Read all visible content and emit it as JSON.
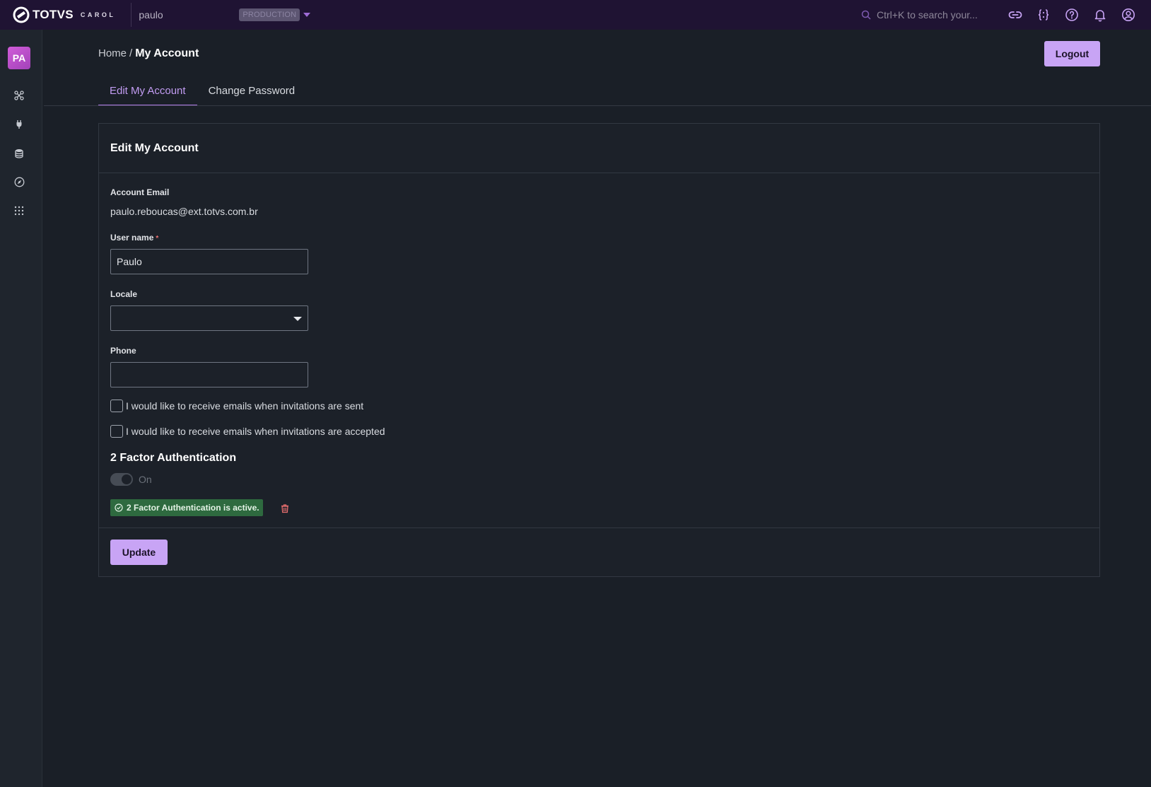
{
  "topbar": {
    "brand_name": "TOTVS",
    "brand_sub": "CAROL",
    "tenant": "paulo",
    "environment": "PRODUCTION",
    "search_placeholder": "Ctrl+K to search your...",
    "icons": [
      "link-icon",
      "code-braces-icon",
      "help-icon",
      "bell-icon",
      "user-circle-icon"
    ]
  },
  "sidebar": {
    "avatar_initials": "PA",
    "icons": [
      "pipeline-icon",
      "plug-icon",
      "database-icon",
      "compass-icon",
      "apps-grid-icon"
    ]
  },
  "breadcrumb": {
    "home": "Home",
    "separator": "/",
    "current": "My Account"
  },
  "header": {
    "logout_label": "Logout"
  },
  "tabs": [
    {
      "label": "Edit My Account",
      "active": true
    },
    {
      "label": "Change Password",
      "active": false
    }
  ],
  "form": {
    "title": "Edit My Account",
    "email_label": "Account Email",
    "email_value": "paulo.reboucas@ext.totvs.com.br",
    "username_label": "User name",
    "username_required_mark": "*",
    "username_value": "Paulo",
    "locale_label": "Locale",
    "locale_value": "",
    "phone_label": "Phone",
    "phone_value": "",
    "checkbox_sent_label": "I would like to receive emails when invitations are sent",
    "checkbox_sent_checked": false,
    "checkbox_accepted_label": "I would like to receive emails when invitations are accepted",
    "checkbox_accepted_checked": false,
    "twofa_title": "2 Factor Authentication",
    "twofa_toggle_label": "On",
    "twofa_status": "2 Factor Authentication is active.",
    "update_label": "Update"
  },
  "colors": {
    "accent": "#c8a4f5",
    "topbar": "#1f1333",
    "background": "#1a1f27",
    "success": "#2e6a3f",
    "danger": "#e96f6f"
  }
}
